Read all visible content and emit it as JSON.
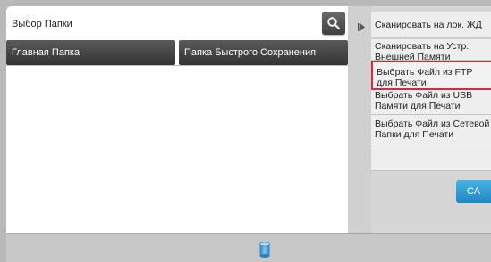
{
  "folder_select": {
    "title": "Выбор Папки",
    "main_folder_label": "Главная Папка",
    "quick_save_folder_label": "Папка Быстрого Сохранения"
  },
  "side_menu": {
    "items": [
      {
        "label": "Сканировать на лок. ЖД"
      },
      {
        "label": "Сканировать на Устр. Внешней Памяти"
      },
      {
        "label": "Выбрать Файл из FTP для Печати",
        "selected": true
      },
      {
        "label": "Выбрать Файл из USB Памяти для Печати"
      },
      {
        "label": "Выбрать Файл из Сетевой Папки для Печати"
      }
    ]
  },
  "ca_label": "CA",
  "colors": {
    "selection_border": "#e3263f",
    "ca_button": "#2a96d4",
    "folder_button": "#444444"
  },
  "icons": [
    "search-icon",
    "expand-arrow-icon",
    "storage-icon"
  ]
}
